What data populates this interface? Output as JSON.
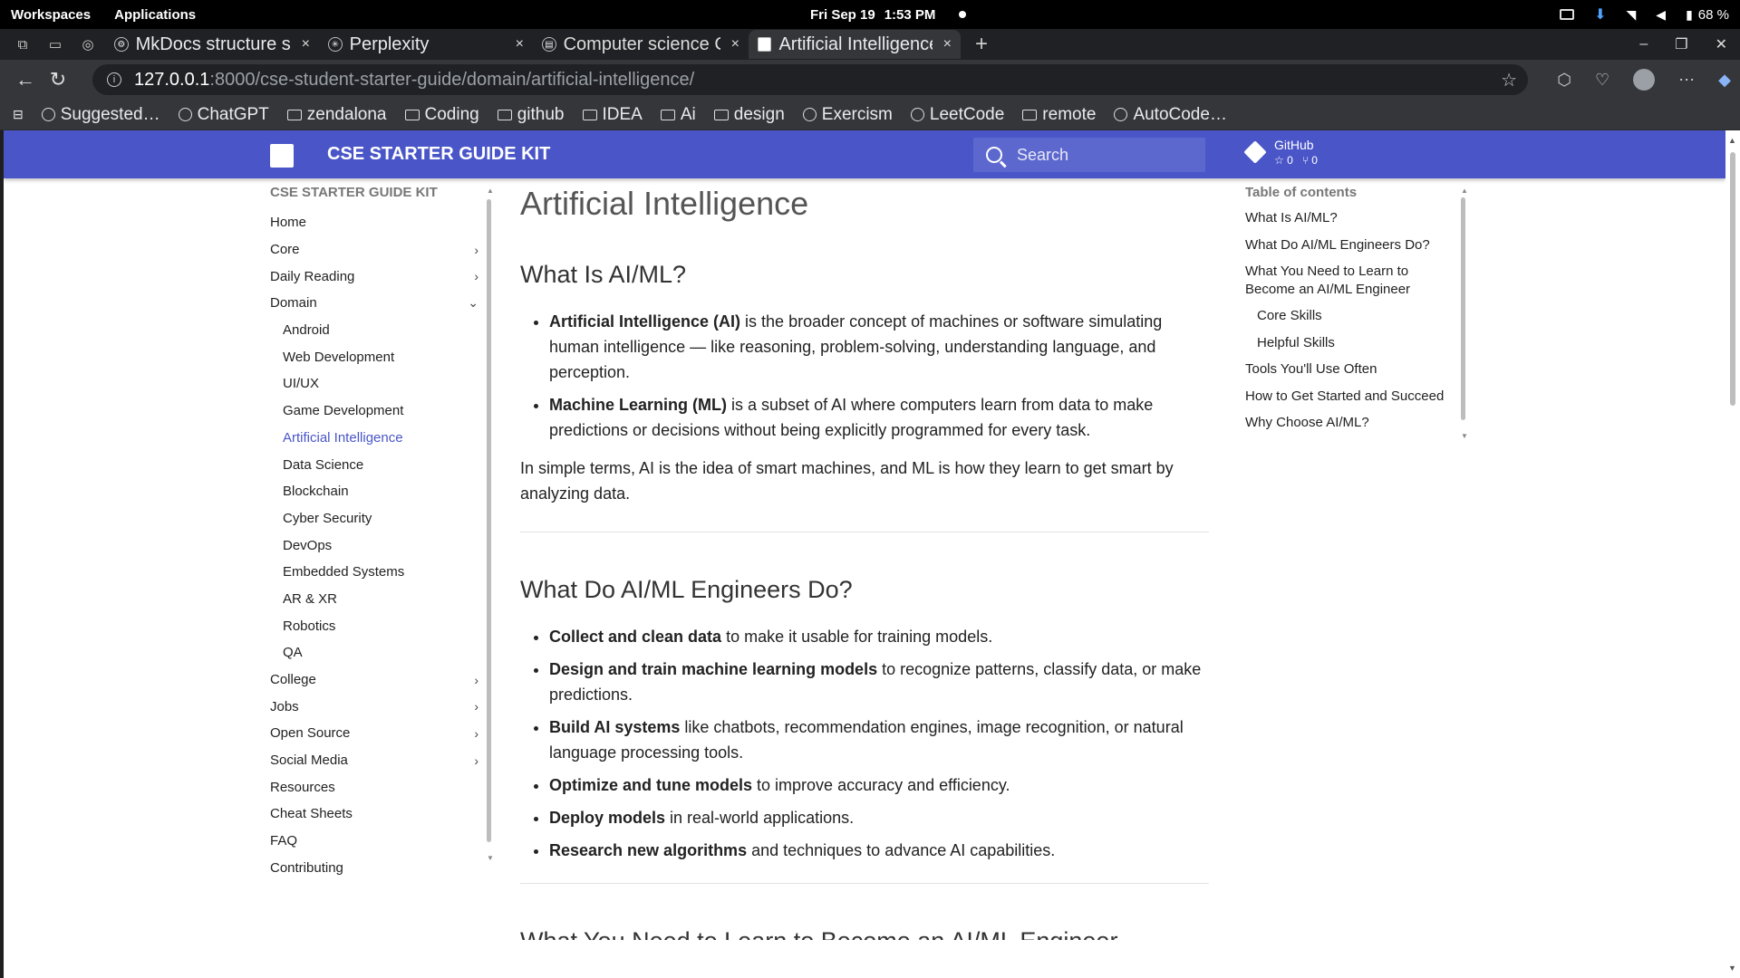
{
  "system": {
    "workspaces": "Workspaces",
    "applications": "Applications",
    "date": "Fri Sep 19",
    "time": "1:53 PM",
    "battery": "68 %"
  },
  "tabs": [
    {
      "title": "MkDocs structure su",
      "close": "×"
    },
    {
      "title": "Perplexity",
      "close": "×"
    },
    {
      "title": "Computer science Ch",
      "close": "×"
    },
    {
      "title": "Artificial Intelligence",
      "close": "×"
    }
  ],
  "new_tab": "+",
  "address": {
    "host": "127.0.0.1",
    "path": ":8000/cse-student-starter-guide/domain/artificial-intelligence/"
  },
  "bookmarks": [
    {
      "label": "Suggested…",
      "kind": "globe"
    },
    {
      "label": "ChatGPT",
      "kind": "globe"
    },
    {
      "label": "zendalona",
      "kind": "folder"
    },
    {
      "label": "Coding",
      "kind": "folder"
    },
    {
      "label": "github",
      "kind": "folder"
    },
    {
      "label": "IDEA",
      "kind": "folder"
    },
    {
      "label": "Ai",
      "kind": "folder"
    },
    {
      "label": "design",
      "kind": "folder"
    },
    {
      "label": "Exercism",
      "kind": "globe"
    },
    {
      "label": "LeetCode",
      "kind": "globe"
    },
    {
      "label": "remote",
      "kind": "folder"
    },
    {
      "label": "AutoCode…",
      "kind": "globe"
    }
  ],
  "site": {
    "title": "CSE STARTER GUIDE KIT",
    "search_placeholder": "Search",
    "github_label": "GitHub",
    "stars": "☆ 0",
    "forks": "⑂ 0",
    "brand_color": "#4a56c8"
  },
  "nav": {
    "heading": "CSE STARTER GUIDE KIT",
    "items": [
      {
        "label": "Home",
        "chevron": ""
      },
      {
        "label": "Core",
        "chevron": "›"
      },
      {
        "label": "Daily Reading",
        "chevron": "›"
      },
      {
        "label": "Domain",
        "chevron": "⌄"
      },
      {
        "label": "Android",
        "sub": true
      },
      {
        "label": "Web Development",
        "sub": true
      },
      {
        "label": "UI/UX",
        "sub": true
      },
      {
        "label": "Game Development",
        "sub": true
      },
      {
        "label": "Artificial Intelligence",
        "sub": true,
        "active": true
      },
      {
        "label": "Data Science",
        "sub": true
      },
      {
        "label": "Blockchain",
        "sub": true
      },
      {
        "label": "Cyber Security",
        "sub": true
      },
      {
        "label": "DevOps",
        "sub": true
      },
      {
        "label": "Embedded Systems",
        "sub": true
      },
      {
        "label": "AR & XR",
        "sub": true
      },
      {
        "label": "Robotics",
        "sub": true
      },
      {
        "label": "QA",
        "sub": true
      },
      {
        "label": "College",
        "chevron": "›"
      },
      {
        "label": "Jobs",
        "chevron": "›"
      },
      {
        "label": "Open Source",
        "chevron": "›"
      },
      {
        "label": "Social Media",
        "chevron": "›"
      },
      {
        "label": "Resources",
        "chevron": ""
      },
      {
        "label": "Cheat Sheets",
        "chevron": ""
      },
      {
        "label": "FAQ",
        "chevron": ""
      },
      {
        "label": "Contributing",
        "chevron": ""
      }
    ]
  },
  "content": {
    "title": "Artificial Intelligence",
    "s1_heading": "What Is AI/ML?",
    "s1_b1_bold": "Artificial Intelligence (AI)",
    "s1_b1_rest": " is the broader concept of machines or software simulating human intelligence — like reasoning, problem-solving, understanding language, and perception.",
    "s1_b2_bold": "Machine Learning (ML)",
    "s1_b2_rest": " is a subset of AI where computers learn from data to make predictions or decisions without being explicitly programmed for every task.",
    "s1_para": "In simple terms, AI is the idea of smart machines, and ML is how they learn to get smart by analyzing data.",
    "s2_heading": "What Do AI/ML Engineers Do?",
    "s2_bullets": [
      {
        "bold": "Collect and clean data",
        "rest": " to make it usable for training models."
      },
      {
        "bold": "Design and train machine learning models",
        "rest": " to recognize patterns, classify data, or make predictions."
      },
      {
        "bold": "Build AI systems",
        "rest": " like chatbots, recommendation engines, image recognition, or natural language processing tools."
      },
      {
        "bold": "Optimize and tune models",
        "rest": " to improve accuracy and efficiency."
      },
      {
        "bold": "Deploy models",
        "rest": " in real-world applications."
      },
      {
        "bold": "Research new algorithms",
        "rest": " and techniques to advance AI capabilities."
      }
    ],
    "s3_heading": "What You Need to Learn to Become an AI/ML Engineer"
  },
  "toc": {
    "heading": "Table of contents",
    "items": [
      {
        "label": "What Is AI/ML?"
      },
      {
        "label": "What Do AI/ML Engineers Do?"
      },
      {
        "label": "What You Need to Learn to Become an AI/ML Engineer"
      },
      {
        "label": "Core Skills",
        "sub": true
      },
      {
        "label": "Helpful Skills",
        "sub": true
      },
      {
        "label": "Tools You'll Use Often"
      },
      {
        "label": "How to Get Started and Succeed"
      },
      {
        "label": "Why Choose AI/ML?"
      }
    ]
  }
}
